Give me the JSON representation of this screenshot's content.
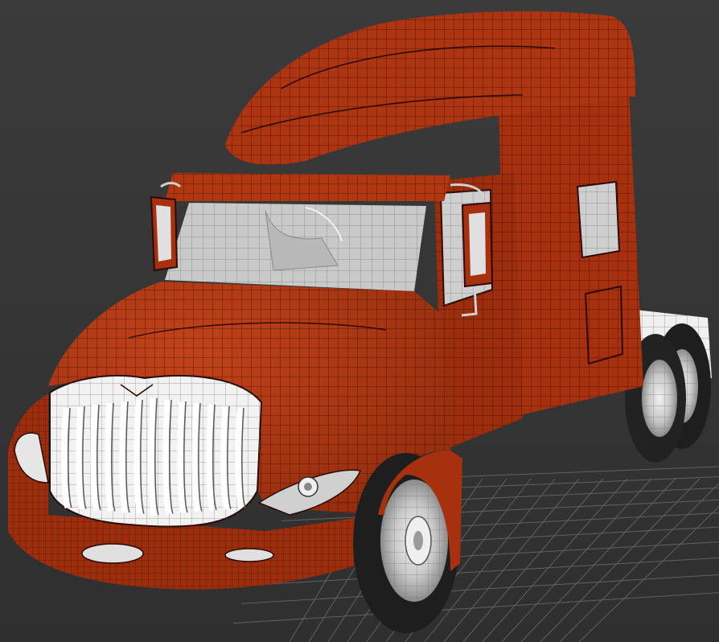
{
  "viewport": {
    "background_top": "#3b3b3b",
    "background_bottom": "#2f2f2f",
    "grid_color": "#6a6a6a"
  },
  "model": {
    "body_color": "#a7310f",
    "body_dark": "#7d2209",
    "body_light": "#c2431a",
    "wire_color": "#2a0a02",
    "chrome_color": "#e9e9e9",
    "glass_color": "#cfcfcf",
    "tire_color": "#1e1e1e",
    "rim_color": "#d8d8d8",
    "frame_color": "#f0f0f0"
  }
}
